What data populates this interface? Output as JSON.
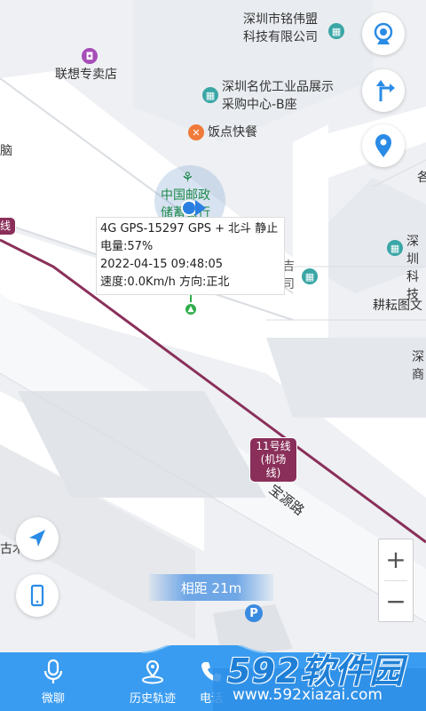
{
  "map": {
    "pois": {
      "mingweimeng": "深圳市铭伟盟科技有限公司",
      "lenovo_store": "联想专卖店",
      "mingyou": "深圳名优工业品展示采购中心-B座",
      "fandian": "饭点快餐",
      "postal_bank": "中国邮政储蓄银行",
      "naomai": "脑",
      "ji_company": "深圳市迈特吉电子有限公司",
      "ji_label": "吉",
      "right_company": "深圳科技",
      "gengyun": "耕耘图文",
      "right_shen": "深商",
      "right_ge": "各",
      "left_gu": "古木",
      "left_xian": "线"
    },
    "metro_badge": "11号线(机场线)",
    "metro_left_badge": "线",
    "road_label": "宝源路"
  },
  "info_popup": {
    "line1": "4G GPS-15297 GPS + 北斗 静止",
    "line2": "电量:57%",
    "line3": "2022-04-15 09:48:05",
    "line4": "速度:0.0Km/h  方向:正北"
  },
  "controls": {
    "zoom_in": "+",
    "zoom_out": "−"
  },
  "distance": "相距 21m",
  "nav": {
    "voice": "微聊",
    "history": "历史轨迹",
    "phone": "电话"
  },
  "watermark": {
    "logo": "592软件园",
    "url": "www.592xiazai.com"
  },
  "colors": {
    "accent_blue": "#2a8be6",
    "metro": "#8a2f5a",
    "postal_green": "#1e8a4c"
  }
}
